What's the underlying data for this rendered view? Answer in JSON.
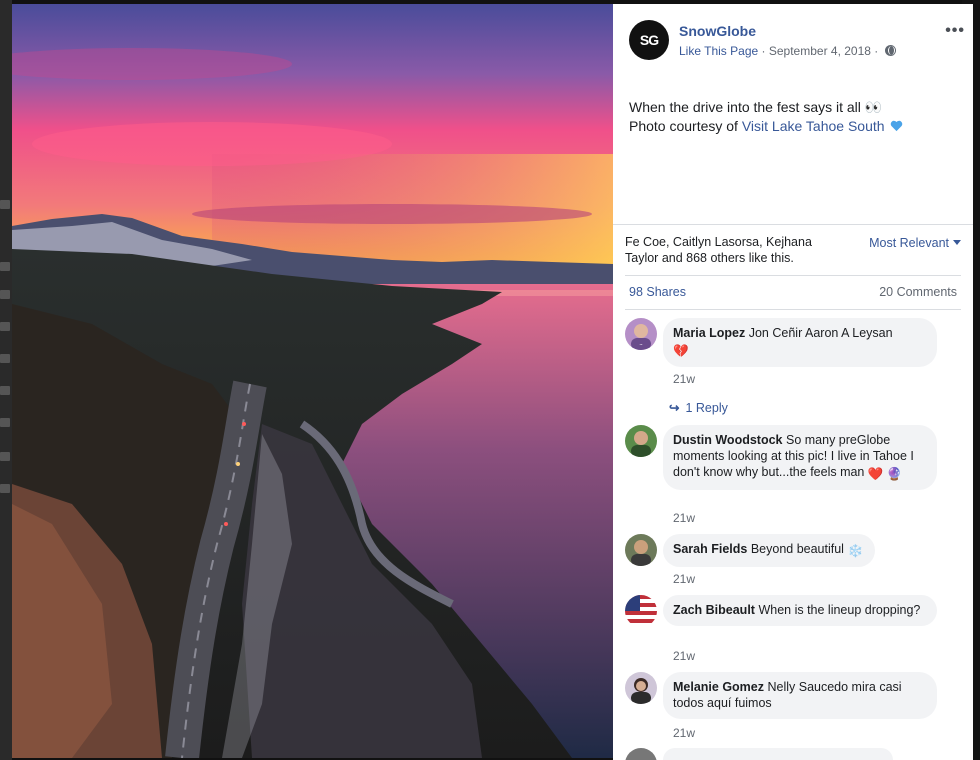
{
  "post": {
    "page_name": "SnowGlobe",
    "avatar_text": "SG",
    "like_page": "Like This Page",
    "separator": "·",
    "date": "September 4, 2018",
    "privacy_icon": "globe-icon",
    "more_icon": "•••",
    "caption_line1": "When the drive into the fest says it all 👀",
    "caption_prefix": "Photo courtesy of ",
    "caption_link": "Visit Lake Tahoe South"
  },
  "engagement": {
    "likes_text": "Fe Coe, Caitlyn Lasorsa, Kejhana Taylor and 868 others like this.",
    "sort_label": "Most Relevant",
    "shares": "98 Shares",
    "comments": "20 Comments"
  },
  "comments": [
    {
      "author": "Maria Lopez",
      "text": "Jon Ceñir Aaron A Leysan",
      "emoji": "💔",
      "time": "21w",
      "reply_label": "1 Reply"
    },
    {
      "author": "Dustin Woodstock",
      "text": "So many preGlobe moments looking at this pic! I live in Tahoe I don't know why but...the feels man",
      "emoji": "❤️ 🔮",
      "time": "21w"
    },
    {
      "author": "Sarah Fields",
      "text": "Beyond beautiful",
      "emoji": "❄️",
      "time": "21w"
    },
    {
      "author": "Zach Bibeault",
      "text": "When is the lineup dropping?",
      "time": "21w"
    },
    {
      "author": "Melanie Gomez",
      "text": "Nelly Saucedo mira casi todos aquí fuimos",
      "time": "21w"
    }
  ],
  "colors": {
    "link": "#385898",
    "bubble": "#f2f3f5",
    "meta": "#616770",
    "sky_top": "#4a4c9a",
    "sky_pink": "#f0508a",
    "sky_gold": "#ffc533"
  }
}
